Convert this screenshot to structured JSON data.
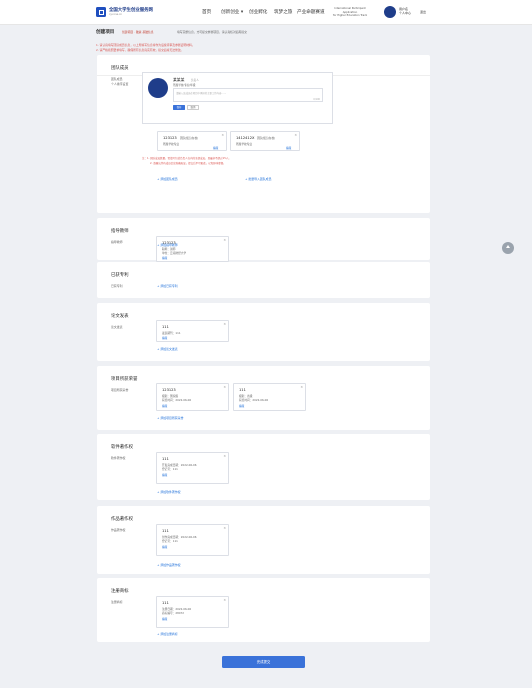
{
  "header": {
    "brand": "全国大学生创业服务网",
    "brand_sub": "cy.ncss.cn",
    "nav": [
      "首页",
      "创新创业 ▾",
      "创业孵化",
      "筑梦之旅",
      "产业命题赛道"
    ],
    "intl_line1": "International Participant Application",
    "intl_line2": "for Higher Education Track",
    "user_name": "用户名",
    "user_sub": "个人中心",
    "logout": "退出"
  },
  "crumb": {
    "title": "创建项目",
    "note": "创建项目 · 融资·基础信息",
    "note2": "填写完整信息，方可提交参赛项目，请认真核对后再提交"
  },
  "warnings": [
    "1. 请认真填写团队成员信息，以上所填写信息将作为后续评审及参赛证明材料。",
    "2. 请严格按照要求填写，确保所有信息真实有效，提交后将无法修改。"
  ],
  "team": {
    "title": "团队成员",
    "label": "团队成员",
    "sub_label": "个人排序设置",
    "member_name": "某某某",
    "member_role": "负责人",
    "member_sub": "所属学校/专业/年级",
    "member_text": "请输入该成员在项目中承担的主要工作内容……",
    "member_count": "0/100",
    "save": "保存",
    "cancel": "取消",
    "cards": [
      {
        "title": "123123",
        "tag": "团队成员(在校)",
        "line": "所属学校专业",
        "edit": "编辑"
      },
      {
        "title": "1412412X",
        "tag": "团队成员(在校)",
        "line": "所属学校专业",
        "edit": "编辑"
      }
    ],
    "notes": [
      "注：1. 团队成员数量，需填写包括负责人在内的全部成员，且最多不超过15人。",
      "2. 请确认所有成员信息准确无误，提交后不可更改，以免影响参赛。"
    ],
    "add": "+ 添加团队成员",
    "add2": "+ 批量导入团队成员"
  },
  "sections": [
    {
      "title": "指导教师",
      "label": "指导教师",
      "items": [
        {
          "title": "123123",
          "lines": [
            "职称：讲师",
            "单位：云南财经大学"
          ],
          "edit": "编辑"
        }
      ],
      "add": "+ 添加指导教师"
    },
    {
      "title": "已获专利",
      "label": "已获专利",
      "items": [],
      "add": "+ 添加已获专利"
    },
    {
      "title": "论文发表",
      "label": "论文发表",
      "items": [
        {
          "title": "111",
          "lines": [
            "发表期刊：111"
          ],
          "edit": "编辑"
        }
      ],
      "add": "+ 添加论文发表"
    },
    {
      "title": "项目所获荣誉",
      "label": "项目所获荣誉",
      "items": [
        {
          "title": "123123",
          "lines": [
            "级别：国家级",
            "获奖时间：2022-06-06"
          ],
          "edit": "编辑"
        },
        {
          "title": "111",
          "lines": [
            "级别：省级",
            "获奖时间：2022-06-06"
          ],
          "edit": "编辑"
        }
      ],
      "add": "+ 添加项目所获荣誉"
    },
    {
      "title": "软件著作权",
      "label": "软件著作权",
      "items": [
        {
          "title": "111",
          "lines": [
            "开发完成日期：2022-06-06",
            "登记号：111"
          ],
          "edit": "编辑"
        }
      ],
      "add": "+ 添加软件著作权"
    },
    {
      "title": "作品著作权",
      "label": "作品著作权",
      "items": [
        {
          "title": "111",
          "lines": [
            "创作完成日期：2022-06-06",
            "登记号：111"
          ],
          "edit": "编辑"
        }
      ],
      "add": "+ 添加作品著作权"
    },
    {
      "title": "注册商标",
      "label": "注册商标",
      "items": [
        {
          "title": "111",
          "lines": [
            "注册日期：2022-06-06",
            "商标编号：28072"
          ],
          "edit": "编辑"
        }
      ],
      "add": "+ 添加注册商标"
    }
  ],
  "submit": "完成提交"
}
